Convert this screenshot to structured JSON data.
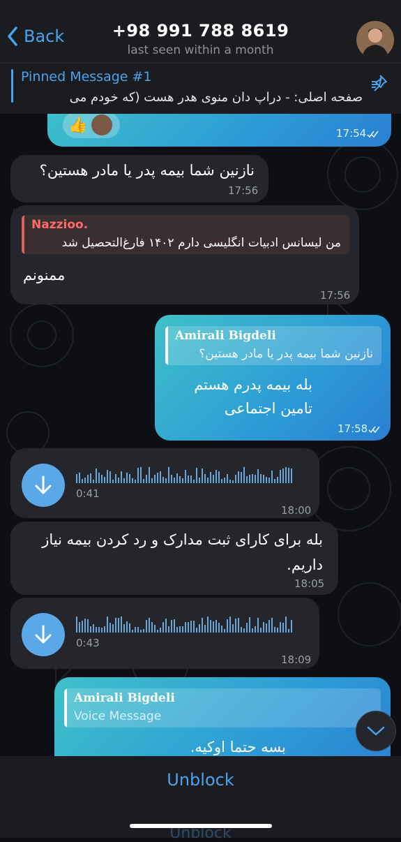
{
  "header": {
    "back_label": "Back",
    "contact_phone": "+98 991 788 8619",
    "status": "last seen within a month"
  },
  "pinned": {
    "title": "Pinned Message #1",
    "text": "صفحه اصلی: - دراپ دان منوی هدر هست (که خودم می"
  },
  "messages": [
    {
      "type": "reaction",
      "emoji": "👍",
      "time": "17:54",
      "direction": "out"
    },
    {
      "type": "text",
      "direction": "in",
      "text": "نازنین شما بیمه پدر یا مادر هستین؟",
      "time": "17:56"
    },
    {
      "type": "reply",
      "direction": "in",
      "quote_name": "Nazzioo.",
      "quote_text": "من لیسانس ادبیات انگلیسی دارم ۱۴۰۲ فارغ‌التحصیل شد",
      "text": "ممنونم",
      "time": "17:56"
    },
    {
      "type": "reply",
      "direction": "out",
      "quote_name": "Amirali Bigdeli",
      "quote_text": "نازنین شما بیمه پدر یا مادر هستین؟",
      "text_line1": "بله بیمه پدرم هستم",
      "text_line2": "تامین اجتماعی",
      "time": "17:58"
    },
    {
      "type": "voice",
      "direction": "in",
      "duration": "0:41",
      "time": "18:00"
    },
    {
      "type": "text",
      "direction": "in",
      "text_line1": "بله برای کارای ثبت مدارک و رد کردن بیمه نیاز",
      "text_line2": "داریم.",
      "time": "18:05"
    },
    {
      "type": "voice",
      "direction": "in",
      "duration": "0:43",
      "time": "18:09"
    },
    {
      "type": "reply",
      "direction": "out",
      "quote_name": "Amirali Bigdeli",
      "quote_text": "Voice Message",
      "text": "بسه حتما اوکیه."
    }
  ],
  "footer": {
    "unblock_label": "Unblock"
  },
  "colors": {
    "accent": "#4aa3ee",
    "incoming_bubble": "#24262c",
    "outgoing_bubble": "#2c9bd6"
  }
}
